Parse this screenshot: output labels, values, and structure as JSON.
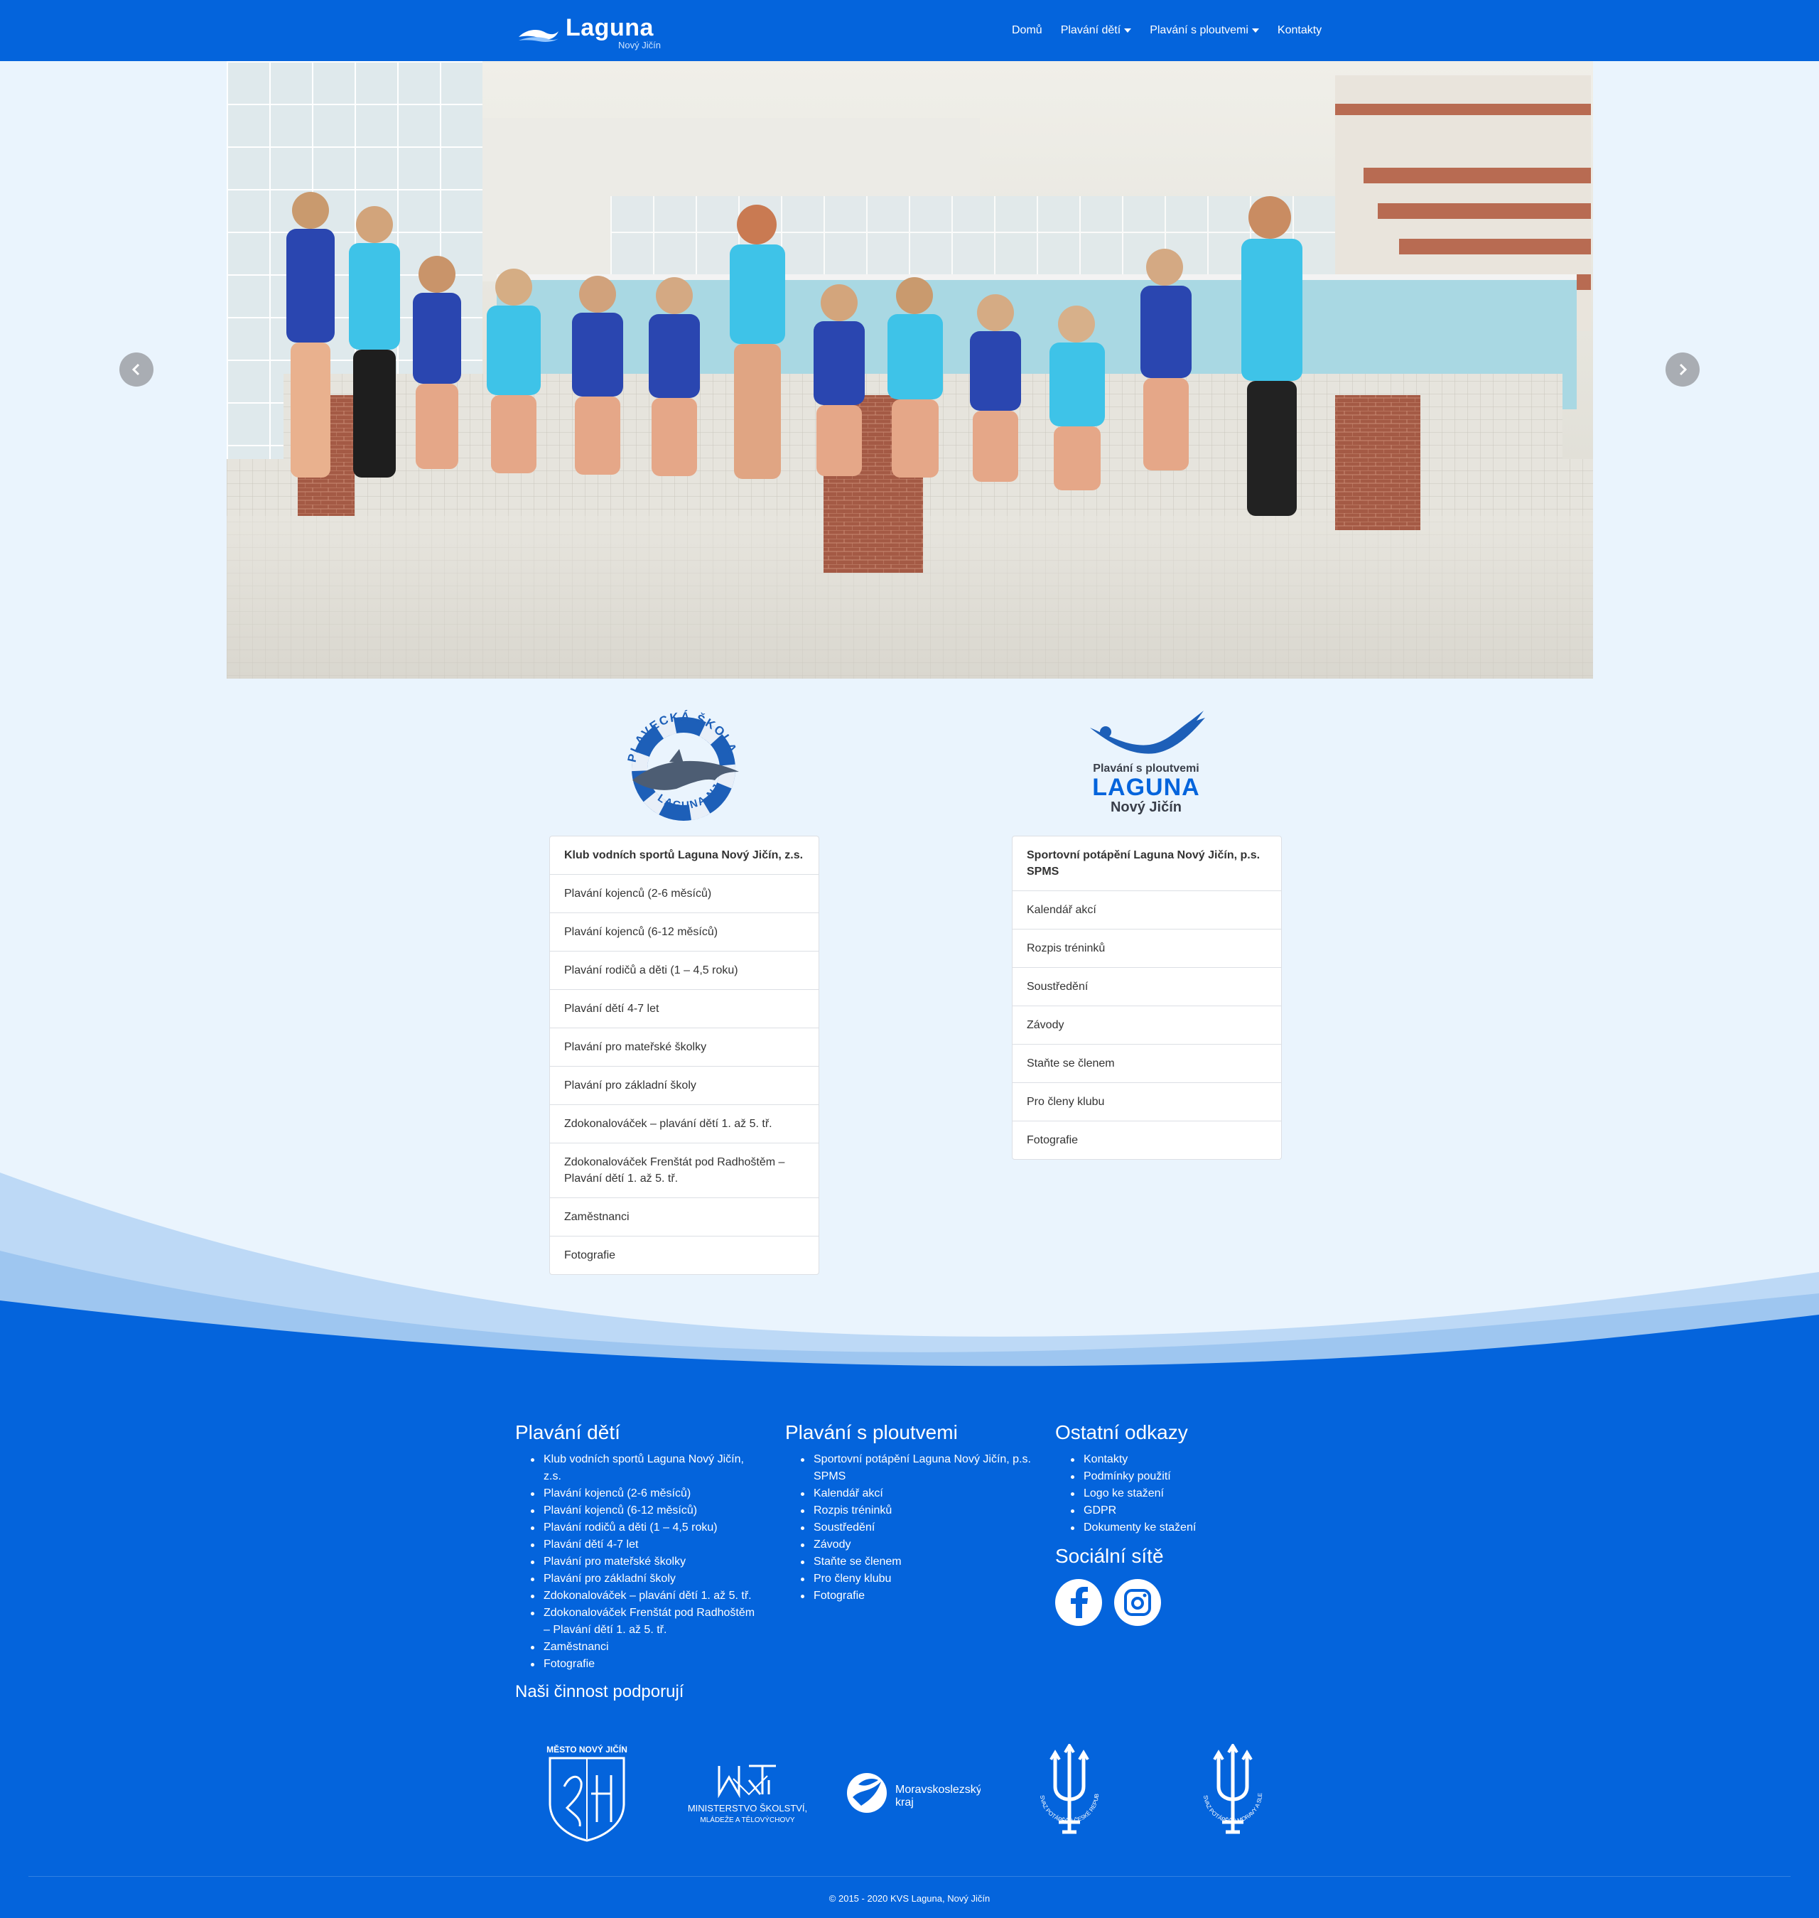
{
  "brand": {
    "name": "Laguna",
    "sub": "Nový Jičín"
  },
  "nav": {
    "items": [
      "Domů",
      "Plavání dětí",
      "Plavání s ploutvemi",
      "Kontakty"
    ]
  },
  "carousel": {
    "slides": 10,
    "active_index": 1
  },
  "logo_b": {
    "line1": "Plavání s ploutvemi",
    "line2": "LAGUNA",
    "line3": "Nový Jičín"
  },
  "logo_a": {
    "top_text": "PLAVECKÁ ŠKOLA",
    "bottom_text": "LAGUNA NJ"
  },
  "list_a": [
    "Klub vodních sportů Laguna Nový Jičín, z.s.",
    "Plavání kojenců (2-6 měsíců)",
    "Plavání kojenců (6-12 měsíců)",
    "Plavání rodičů a děti (1 – 4,5 roku)",
    "Plavání dětí 4-7 let",
    "Plavání pro mateřské školky",
    "Plavání pro základní školy",
    "Zdokonalováček – plavání dětí 1. až 5. tř.",
    "Zdokonalováček Frenštát pod Radhoštěm – Plavání dětí 1. až 5. tř.",
    "Zaměstnanci",
    "Fotografie"
  ],
  "list_b": [
    "Sportovní potápění Laguna Nový Jičín, p.s. SPMS",
    "Kalendář akcí",
    "Rozpis tréninků",
    "Soustředění",
    "Závody",
    "Staňte se členem",
    "Pro členy klubu",
    "Fotografie"
  ],
  "footer": {
    "col1": {
      "title": "Plavání dětí",
      "items": [
        "Klub vodních sportů Laguna Nový Jičín, z.s.",
        "Plavání kojenců (2-6 měsíců)",
        "Plavání kojenců (6-12 měsíců)",
        "Plavání rodičů a děti (1 – 4,5 roku)",
        "Plavání dětí 4-7 let",
        "Plavání pro mateřské školky",
        "Plavání pro základní školy",
        "Zdokonalováček – plavání dětí 1. až 5. tř.",
        "Zdokonalováček Frenštát pod Radhoštěm – Plavání dětí 1. až 5. tř.",
        "Zaměstnanci",
        "Fotografie"
      ]
    },
    "col2": {
      "title": "Plavání s ploutvemi",
      "items": [
        "Sportovní potápění Laguna Nový Jičín, p.s. SPMS",
        "Kalendář akcí",
        "Rozpis tréninků",
        "Soustředění",
        "Závody",
        "Staňte se členem",
        "Pro členy klubu",
        "Fotografie"
      ]
    },
    "col3": {
      "title": "Ostatní odkazy",
      "items": [
        "Kontakty",
        "Podmínky použití",
        "Logo ke stažení",
        "GDPR",
        "Dokumenty ke stažení"
      ]
    },
    "social_title": "Sociální sítě",
    "support_title": "Naši činnost podporují",
    "sponsors": {
      "mesto": "MĚSTO NOVÝ JIČÍN",
      "msmt1": "MINISTERSTVO ŠKOLSTVÍ,",
      "msmt2": "MLÁDEŽE A TĚLOVÝCHOVY",
      "kraj1": "Moravskoslezský",
      "kraj2": "kraj",
      "svaz1": "SVAZ POTÁPĚČŮ ČESKÉ REPUBLIKY",
      "svaz2": "SVAZ POTÁPĚČŮ MORAVY A SLEZSKA"
    },
    "copyright": "© 2015 - 2020 KVS Laguna, Nový Jičín"
  },
  "colors": {
    "primary": "#0464dc",
    "page_bg": "#eaf4fd",
    "wave_light": "#bdd9f6",
    "wave_mid": "#9ec6f0"
  }
}
